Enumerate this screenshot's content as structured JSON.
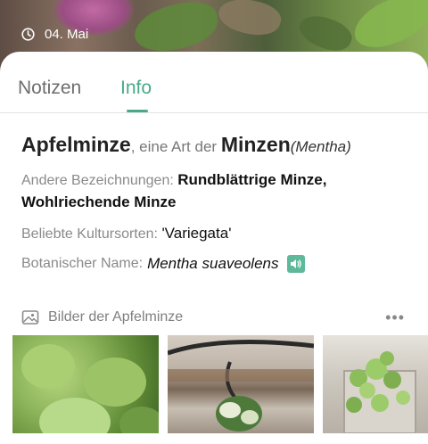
{
  "header": {
    "date": "04. Mai",
    "icon": "clock-icon"
  },
  "tabs": [
    {
      "label": "Notizen",
      "active": false
    },
    {
      "label": "Info",
      "active": true
    }
  ],
  "accent_color": "#49a98a",
  "plant": {
    "name": "Apfelminze",
    "kind_prefix": ", eine Art der ",
    "genus": "Minzen",
    "genus_latin": "(Mentha)"
  },
  "info": {
    "other_names_label": "Andere Bezeichnungen:",
    "other_names_value": "Rundblättrige Minze, Wohlriechende Minze",
    "cultivars_label": "Beliebte Kultursorten:",
    "cultivars_value": "'Variegata'",
    "botanical_label": "Botanischer Name:",
    "botanical_value": "Mentha suaveolens",
    "speaker_icon": "speaker-icon"
  },
  "gallery": {
    "title": "Bilder der Apfelminze",
    "icon": "image-icon",
    "more_icon": "more-dots-icon",
    "more_label": "•••",
    "images": [
      "mint-leaves-photo",
      "mint-sprout-photo",
      "mint-pot-photo"
    ]
  }
}
